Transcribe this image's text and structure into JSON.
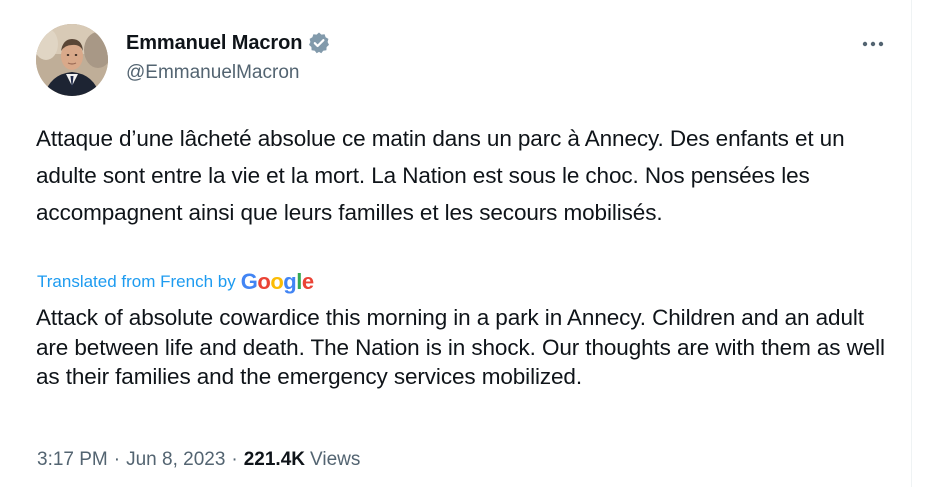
{
  "author": {
    "name": "Emmanuel Macron",
    "handle": "@EmmanuelMacron",
    "verified_badge_icon": "verified-badge-icon",
    "badge_color": "#829aab"
  },
  "more_icon": "more-options-icon",
  "tweet": {
    "text": "Attaque d’une lâcheté absolue ce matin dans un parc à Annecy. Des enfants et un adulte sont entre la vie et la mort. La Nation est sous le choc. Nos pensées les accompagnent ainsi que leurs familles et les secours mobilisés."
  },
  "translation": {
    "label": "Translated from French by",
    "provider_letters": [
      "G",
      "o",
      "o",
      "g",
      "l",
      "e"
    ],
    "text": "Attack of absolute cowardice this morning in a park in Annecy. Children and an adult are between life and death. The Nation is in shock. Our thoughts are with them as well as their families and the emergency services mobilized."
  },
  "meta": {
    "time": "3:17 PM",
    "separator": "·",
    "date": "Jun 8, 2023",
    "views_count": "221.4K",
    "views_label": "Views"
  },
  "colors": {
    "link_blue": "#1d9bf0",
    "secondary_text": "#536471",
    "primary_text": "#0f1419"
  }
}
